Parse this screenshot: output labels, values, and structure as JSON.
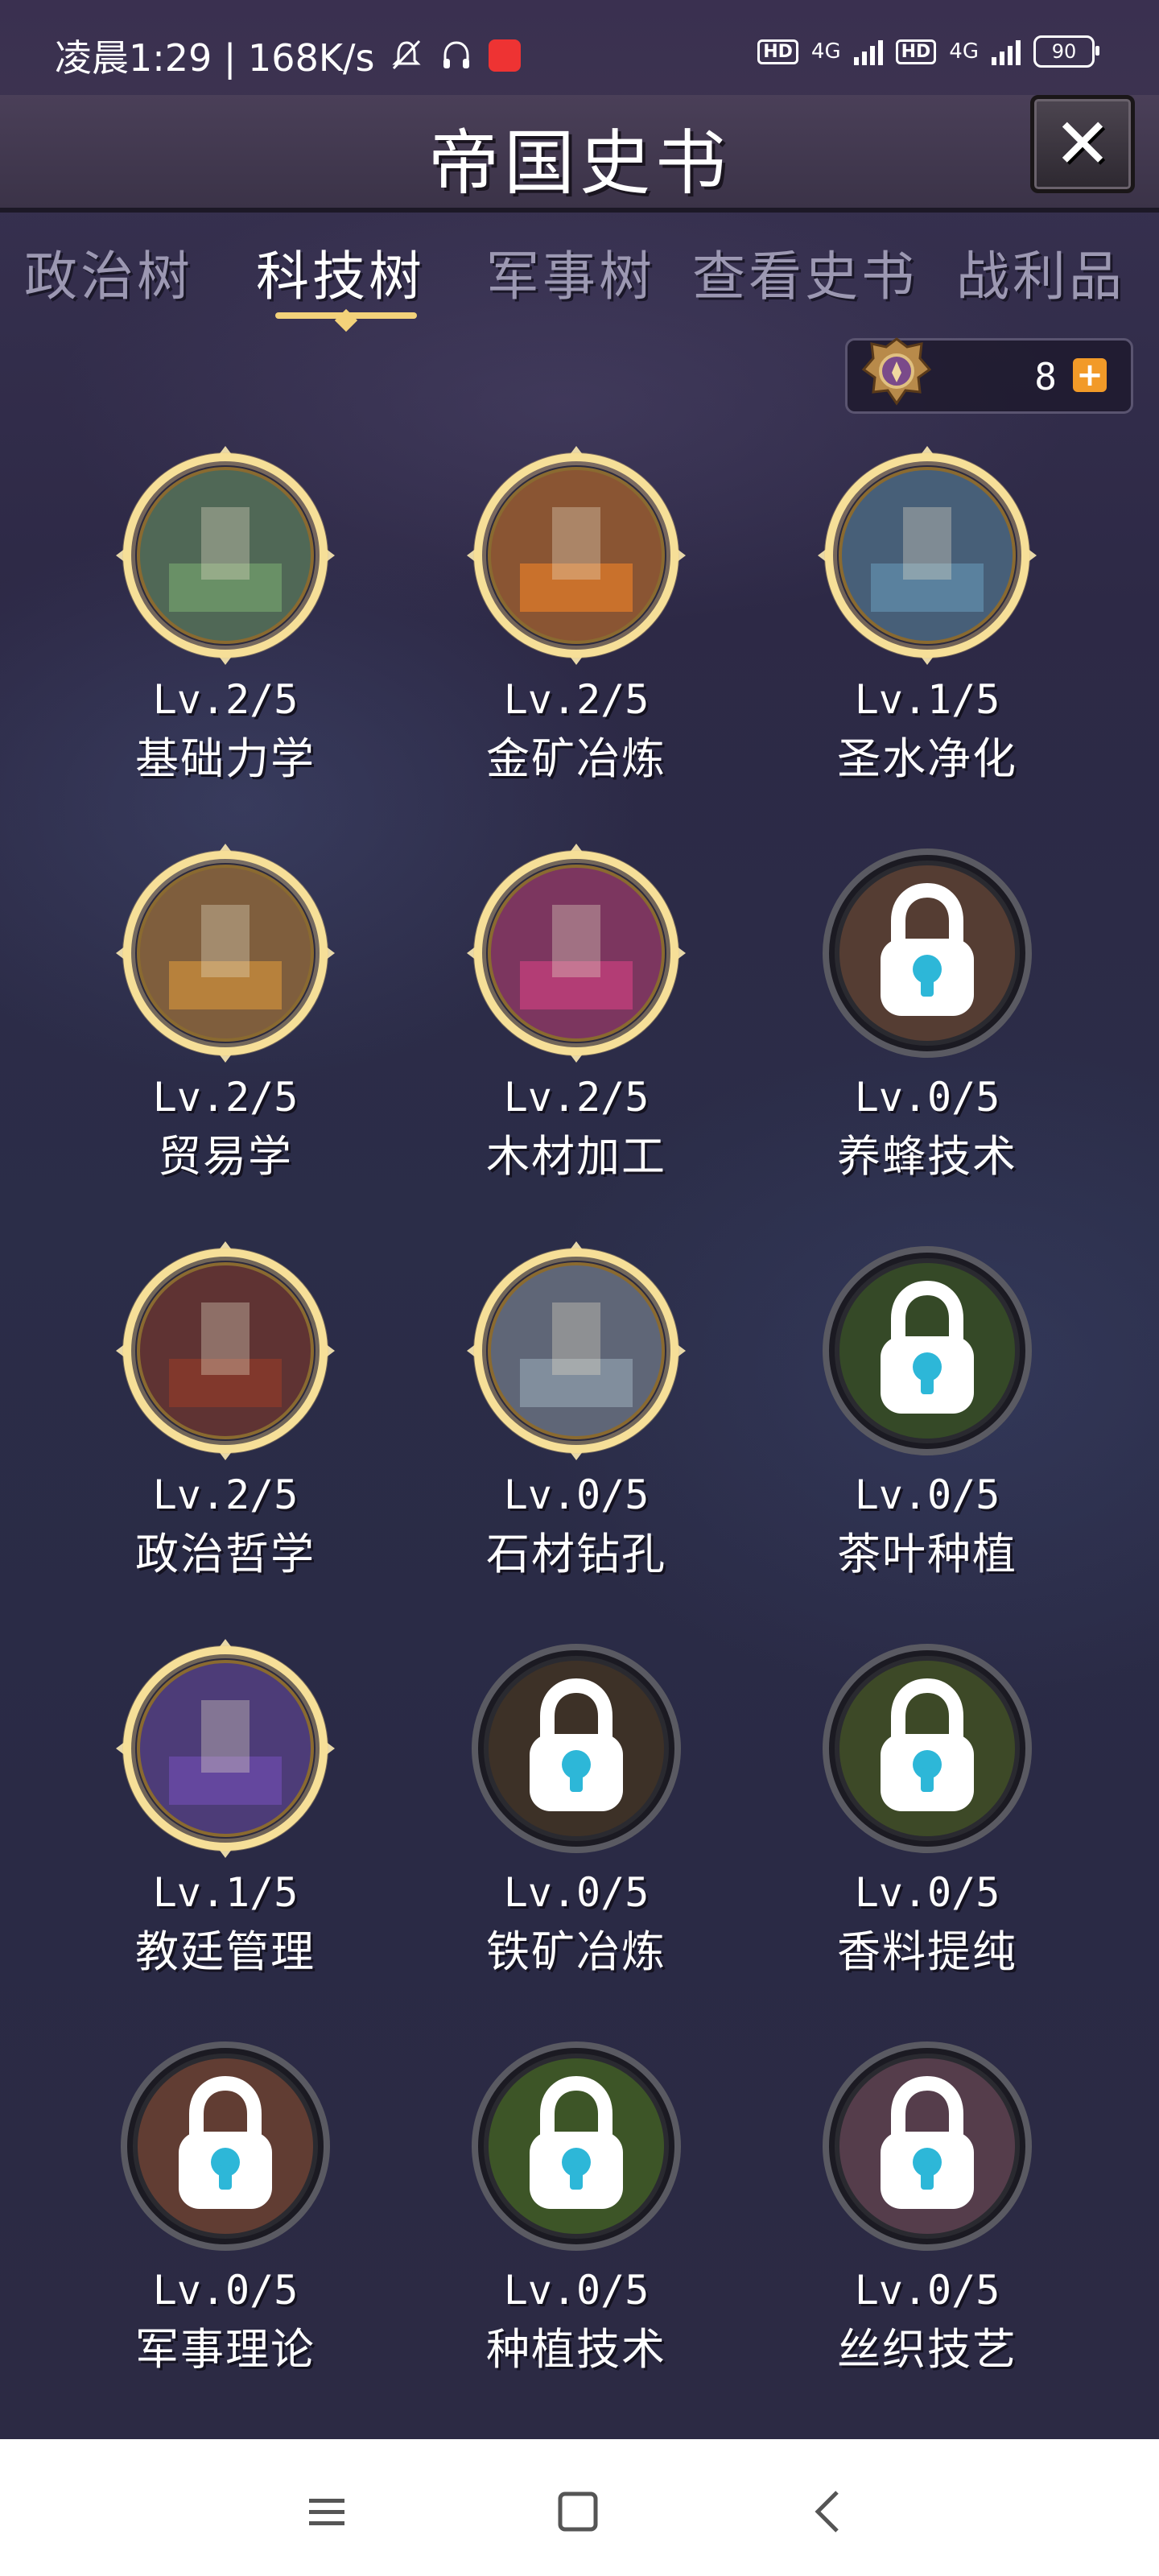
{
  "status_bar": {
    "time_text": "凌晨1:29 | 168K/s",
    "network_1": "4G",
    "network_2": "4G",
    "hd_label": "HD",
    "battery": "90"
  },
  "header": {
    "title": "帝国史书",
    "close_icon": "close-x-icon"
  },
  "tabs": [
    {
      "label": "政治树",
      "active": false
    },
    {
      "label": "科技树",
      "active": true
    },
    {
      "label": "军事树",
      "active": false
    },
    {
      "label": "查看史书",
      "active": false
    },
    {
      "label": "战利品",
      "active": false
    }
  ],
  "currency": {
    "icon": "medal-icon",
    "value": "8",
    "add_icon": "plus-icon"
  },
  "techs": [
    {
      "level": "Lv.2/5",
      "name": "基础力学",
      "locked": false,
      "accent": "#6f9a6a"
    },
    {
      "level": "Lv.2/5",
      "name": "金矿冶炼",
      "locked": false,
      "accent": "#d8782a"
    },
    {
      "level": "Lv.1/5",
      "name": "圣水净化",
      "locked": false,
      "accent": "#5f8aa8"
    },
    {
      "level": "Lv.2/5",
      "name": "贸易学",
      "locked": false,
      "accent": "#c5893c"
    },
    {
      "level": "Lv.2/5",
      "name": "木材加工",
      "locked": false,
      "accent": "#c0407a"
    },
    {
      "level": "Lv.0/5",
      "name": "养蜂技术",
      "locked": true,
      "accent": "#6a4a3a"
    },
    {
      "level": "Lv.2/5",
      "name": "政治哲学",
      "locked": false,
      "accent": "#8a3a2a"
    },
    {
      "level": "Lv.0/5",
      "name": "石材钻孔",
      "locked": false,
      "accent": "#8a98a6"
    },
    {
      "level": "Lv.0/5",
      "name": "茶叶种植",
      "locked": true,
      "accent": "#3f5a2a"
    },
    {
      "level": "Lv.1/5",
      "name": "教廷管理",
      "locked": false,
      "accent": "#6a4aa8"
    },
    {
      "level": "Lv.0/5",
      "name": "铁矿冶炼",
      "locked": true,
      "accent": "#4a3a2a"
    },
    {
      "level": "Lv.0/5",
      "name": "香料提纯",
      "locked": true,
      "accent": "#4a5a2a"
    },
    {
      "level": "Lv.0/5",
      "name": "军事理论",
      "locked": true,
      "accent": "#7a4a3a"
    },
    {
      "level": "Lv.0/5",
      "name": "种植技术",
      "locked": true,
      "accent": "#4a6a2a"
    },
    {
      "level": "Lv.0/5",
      "name": "丝织技艺",
      "locked": true,
      "accent": "#6a4a5a"
    }
  ],
  "nav_bar": {
    "menu_icon": "menu-icon",
    "home_icon": "home-icon",
    "back_icon": "back-icon"
  }
}
